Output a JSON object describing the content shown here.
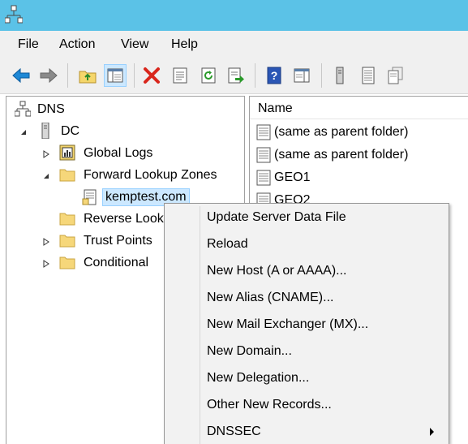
{
  "menu": [
    "File",
    "Action",
    "View",
    "Help"
  ],
  "tree": {
    "root": "DNS",
    "server": "DC",
    "items": {
      "global_logs": "Global Logs",
      "forward_zones": "Forward Lookup Zones",
      "zone": "kemptest.com",
      "reverse_zones": "Reverse Look",
      "trust_points": "Trust Points",
      "conditional": "Conditional"
    }
  },
  "list": {
    "header": "Name",
    "rows": [
      "(same as parent folder)",
      "(same as parent folder)",
      "GEO1",
      "GEO2"
    ]
  },
  "context_menu": [
    "Update Server Data File",
    "Reload",
    "New Host (A or AAAA)...",
    "New Alias (CNAME)...",
    "New Mail Exchanger (MX)...",
    "New Domain...",
    "New Delegation...",
    "Other New Records...",
    "DNSSEC"
  ],
  "colors": {
    "titlebar": "#5bc2e7",
    "selection": "#cce8ff",
    "menu_bg": "#f2f2f2"
  }
}
